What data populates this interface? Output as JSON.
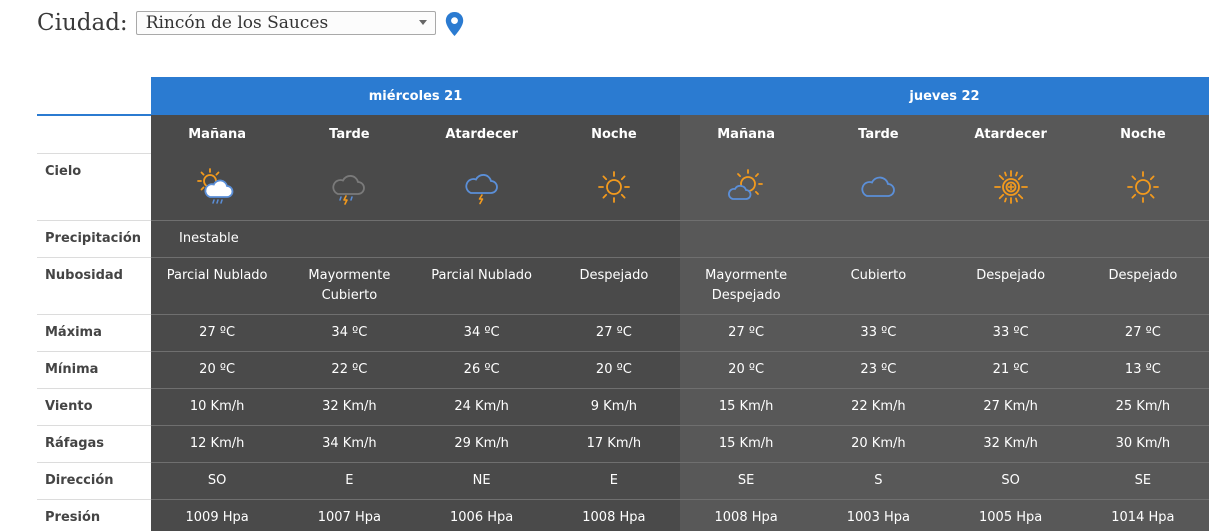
{
  "city": {
    "label": "Ciudad:",
    "selected": "Rincón de los Sauces"
  },
  "days": [
    {
      "label": "miércoles 21"
    },
    {
      "label": "jueves 22"
    }
  ],
  "periods": [
    "Mañana",
    "Tarde",
    "Atardecer",
    "Noche",
    "Mañana",
    "Tarde",
    "Atardecer",
    "Noche"
  ],
  "row_labels": {
    "sky": "Cielo",
    "precip": "Precipitación",
    "cloud": "Nubosidad",
    "max": "Máxima",
    "min": "Mínima",
    "wind": "Viento",
    "gusts": "Ráfagas",
    "dir": "Dirección",
    "pressure": "Presión"
  },
  "sky_icons": [
    "sun-cloud-rain-icon",
    "cloud-storm-icon",
    "cloud-lightning-icon",
    "sun-icon",
    "sun-cloud-icon",
    "cloud-icon",
    "sun-halo-icon",
    "sun-icon"
  ],
  "precipitation": {
    "day1": "Inestable",
    "day2": ""
  },
  "cloudiness": [
    "Parcial Nublado",
    "Mayormente Cubierto",
    "Parcial Nublado",
    "Despejado",
    "Mayormente Despejado",
    "Cubierto",
    "Despejado",
    "Despejado"
  ],
  "max": [
    "27 ºC",
    "34 ºC",
    "34 ºC",
    "27 ºC",
    "27 ºC",
    "33 ºC",
    "33 ºC",
    "27 ºC"
  ],
  "min": [
    "20 ºC",
    "22 ºC",
    "26 ºC",
    "20 ºC",
    "20 ºC",
    "23 ºC",
    "21 ºC",
    "13 ºC"
  ],
  "wind": [
    "10 Km/h",
    "32 Km/h",
    "24 Km/h",
    "9 Km/h",
    "15 Km/h",
    "22 Km/h",
    "27 Km/h",
    "25 Km/h"
  ],
  "gusts": [
    "12 Km/h",
    "34 Km/h",
    "29 Km/h",
    "17 Km/h",
    "15 Km/h",
    "20 Km/h",
    "32 Km/h",
    "30 Km/h"
  ],
  "direction": [
    "SO",
    "E",
    "NE",
    "E",
    "SE",
    "S",
    "SO",
    "SE"
  ],
  "pressure": [
    "1009 Hpa",
    "1007 Hpa",
    "1006 Hpa",
    "1008 Hpa",
    "1008 Hpa",
    "1003 Hpa",
    "1005 Hpa",
    "1014 Hpa"
  ],
  "colors": {
    "header_blue": "#2b7bd1",
    "day1_bg": "#4a4a4a",
    "day2_bg": "#585858",
    "icon_orange": "#f39a1d",
    "icon_blue": "#5b8fd8",
    "icon_grey": "#7a7a7a"
  }
}
